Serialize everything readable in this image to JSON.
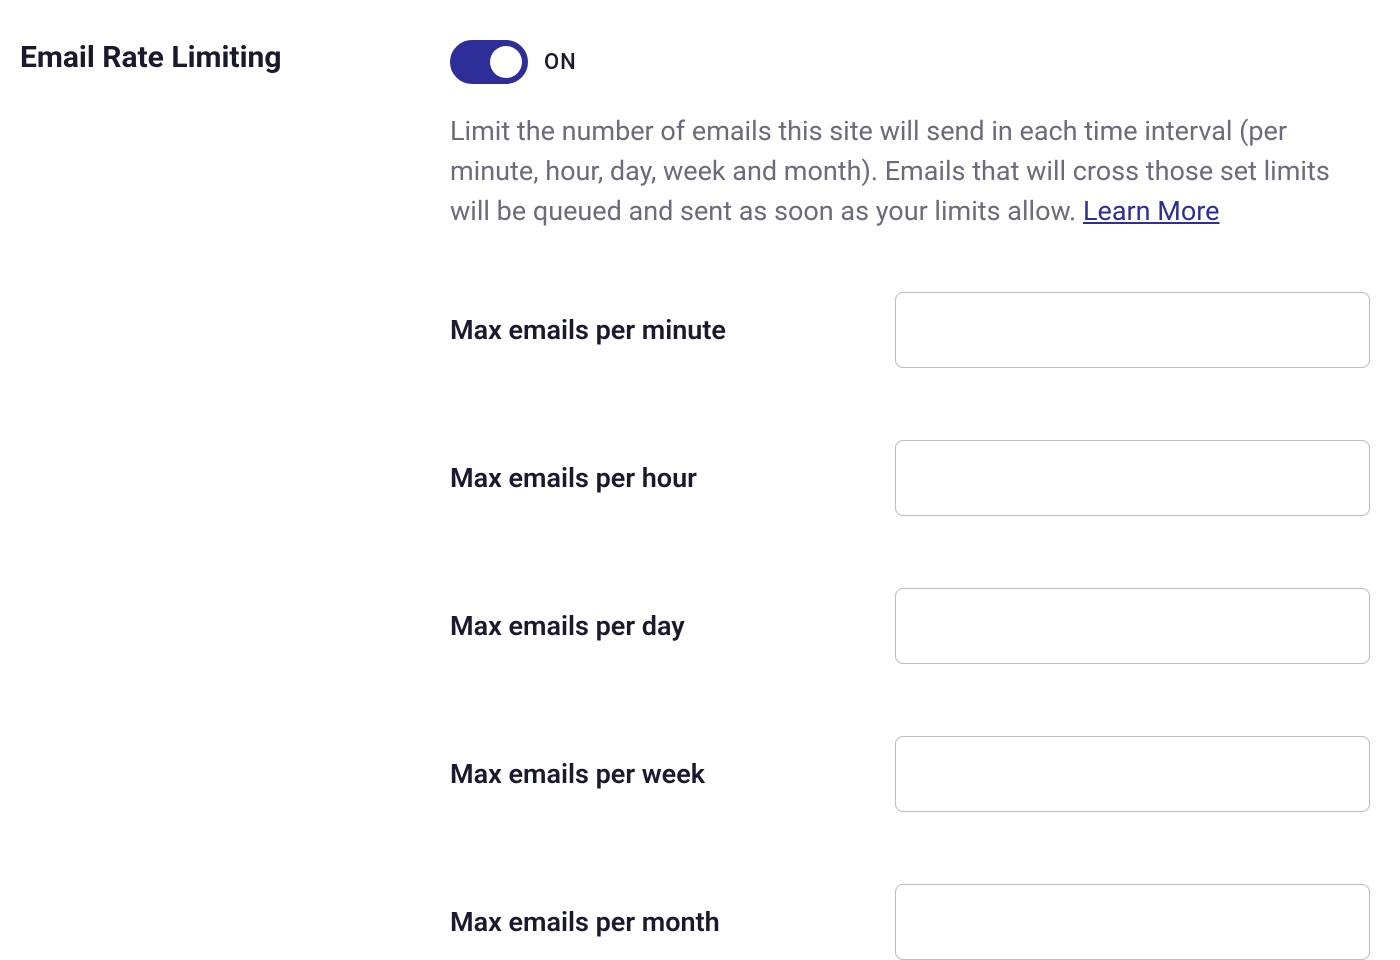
{
  "section": {
    "heading": "Email Rate Limiting",
    "toggle": {
      "state_label": "ON",
      "on": true
    },
    "description_text": "Limit the number of emails this site will send in each time interval (per minute, hour, day, week and month). Emails that will cross those set limits will be queued and sent as soon as your limits allow. ",
    "learn_more_label": "Learn More",
    "fields": {
      "minute": {
        "label": "Max emails per minute",
        "value": ""
      },
      "hour": {
        "label": "Max emails per hour",
        "value": ""
      },
      "day": {
        "label": "Max emails per day",
        "value": ""
      },
      "week": {
        "label": "Max emails per week",
        "value": ""
      },
      "month": {
        "label": "Max emails per month",
        "value": ""
      }
    }
  }
}
